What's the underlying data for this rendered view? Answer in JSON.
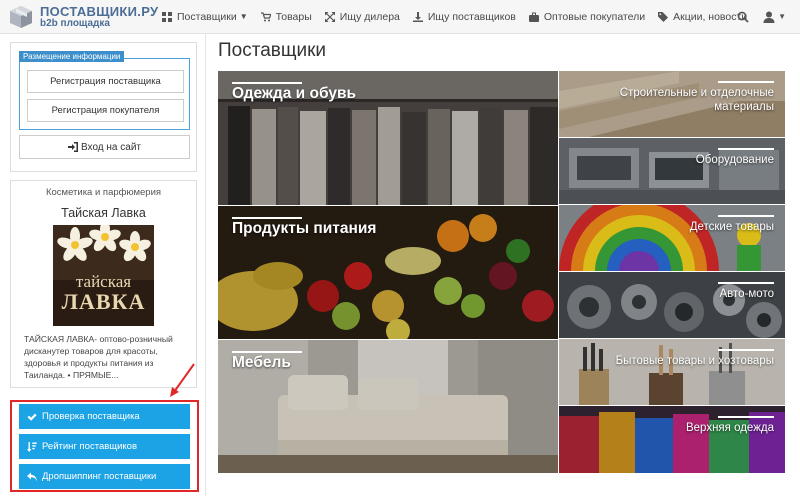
{
  "brand": {
    "title": "ПОСТАВЩИКИ.РУ",
    "subtitle": "b2b площадка",
    "color": "#4b6d96"
  },
  "nav": {
    "items": [
      {
        "label": "Поставщики",
        "icon": "grid-icon",
        "has_caret": true
      },
      {
        "label": "Товары",
        "icon": "cart-icon"
      },
      {
        "label": "Ищу дилера",
        "icon": "expand-icon"
      },
      {
        "label": "Ищу поставщиков",
        "icon": "download-icon"
      },
      {
        "label": "Оптовые покупатели",
        "icon": "briefcase-icon"
      },
      {
        "label": "Акции, новости",
        "icon": "tags-icon"
      }
    ],
    "search_icon": "search-icon",
    "user_icon": "user-icon"
  },
  "sidebar": {
    "registration": {
      "label": "Размещение информации",
      "supplier_btn": "Регистрация поставщика",
      "buyer_btn": "Регистрация покупателя",
      "login_btn": "Вход на сайт"
    },
    "promo": {
      "category": "Косметика и парфюмерия",
      "name": "Тайская Лавка",
      "logo_line1": "тайская",
      "logo_line2": "ЛАВКА",
      "description": "ТАЙСКАЯ ЛАВКА- оптово-розничный дисканутер товаров для красоты, здоровья и продукты питания из Таиланда. • ПРЯМЫЕ..."
    },
    "actions": [
      {
        "label": "Проверка поставщика",
        "icon": "check-icon"
      },
      {
        "label": "Рейтинг поставщиков",
        "icon": "sort-icon"
      },
      {
        "label": "Дропшиппинг поставщики",
        "icon": "reply-icon"
      }
    ],
    "action_color": "#1ca3e6",
    "highlight_color": "#e02828"
  },
  "main": {
    "title": "Поставщики",
    "categories_big": [
      {
        "label": "Одежда и обувь"
      },
      {
        "label": "Продукты питания"
      },
      {
        "label": "Мебель"
      }
    ],
    "categories_small": [
      {
        "label_line1": "Строительные и отделочные",
        "label_line2": "материалы"
      },
      {
        "label_line1": "Оборудование"
      },
      {
        "label_line1": "Детские товары"
      },
      {
        "label_line1": "Авто-мото"
      },
      {
        "label_line1": "Бытовые товары и хозтовары"
      },
      {
        "label_line1": "Верхняя одежда"
      }
    ]
  }
}
